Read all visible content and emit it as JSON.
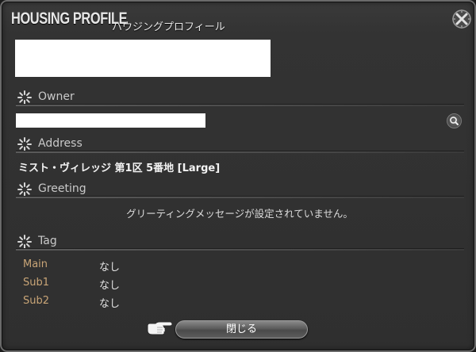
{
  "window": {
    "title": "HOUSING PROFILE",
    "subtitle": "ハウジングプロフィール"
  },
  "sections": {
    "owner": {
      "label": "Owner"
    },
    "address": {
      "label": "Address",
      "value": "ミスト・ヴィレッジ 第1区 5番地 [Large]"
    },
    "greeting": {
      "label": "Greeting",
      "value": "グリーティングメッセージが設定されていません。"
    },
    "tag": {
      "label": "Tag",
      "rows": [
        {
          "key": "Main",
          "value": "なし"
        },
        {
          "key": "Sub1",
          "value": "なし"
        },
        {
          "key": "Sub2",
          "value": "なし"
        }
      ]
    }
  },
  "footer": {
    "close_label": "閉じる"
  },
  "icons": {
    "close": "close-x-icon",
    "section": "sparkle-icon",
    "search": "search-icon",
    "pointer": "pointing-hand-icon"
  },
  "colors": {
    "tag_key": "#c9a577",
    "window_bg": "#333333"
  }
}
